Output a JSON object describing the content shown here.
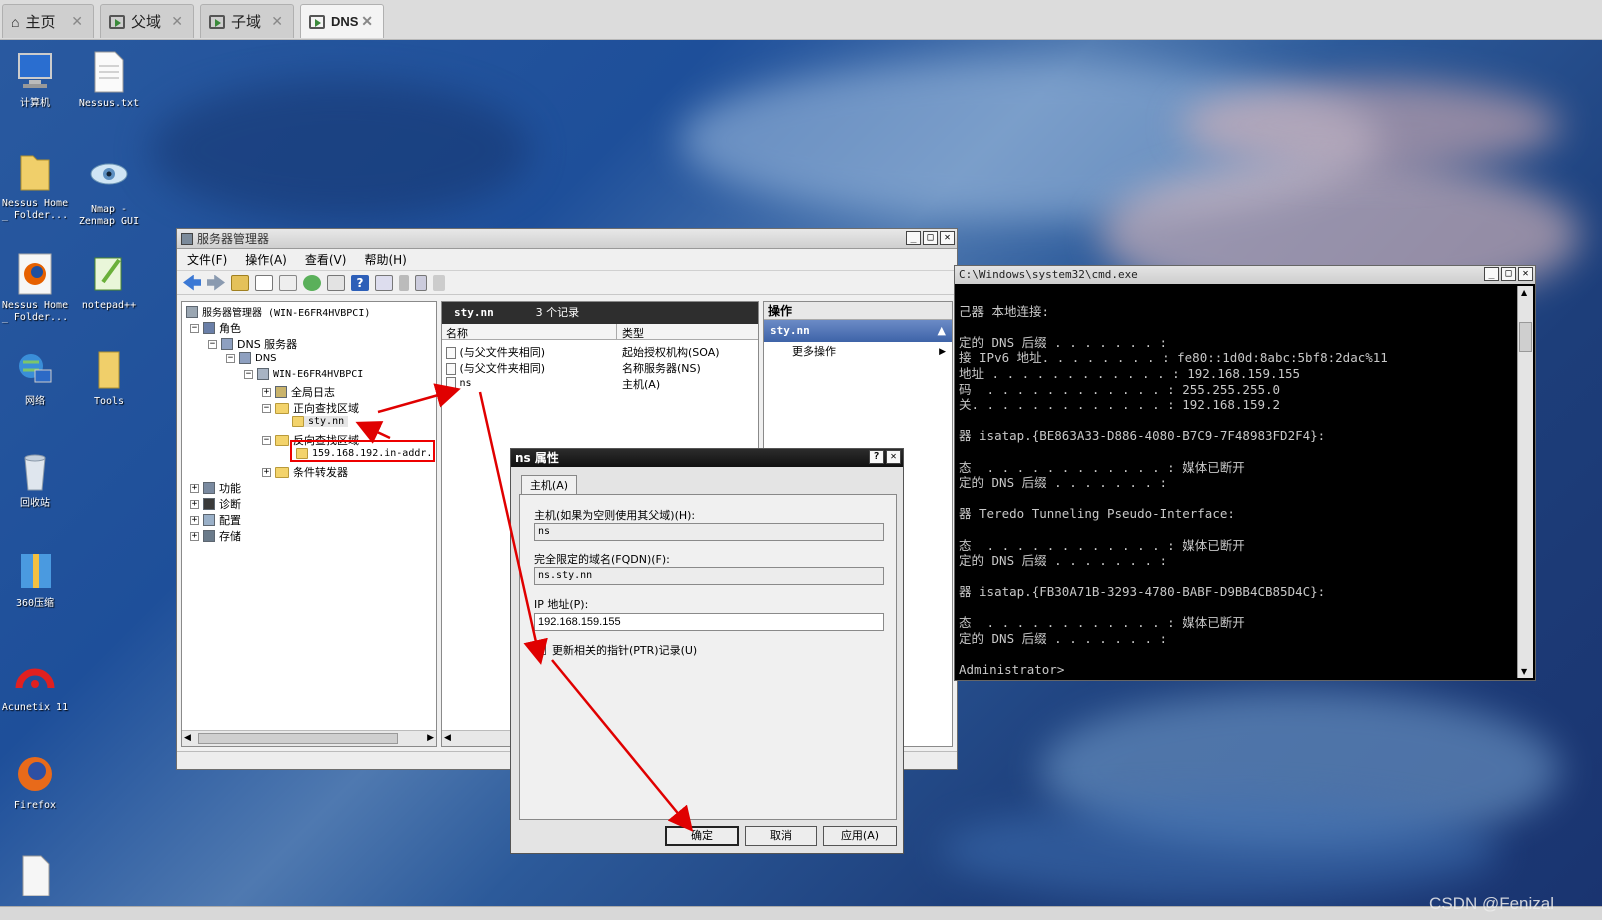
{
  "tabs": [
    {
      "label": "主页",
      "active": false
    },
    {
      "label": "父域",
      "active": false
    },
    {
      "label": "子域",
      "active": false
    },
    {
      "label": "DNS",
      "active": true
    }
  ],
  "desktop_icons": [
    {
      "label": "计算机",
      "icon": "computer-icon"
    },
    {
      "label": "Nessus.txt",
      "icon": "text-file-icon"
    },
    {
      "label": "Nessus Home _ Folder...",
      "icon": "folder-icon"
    },
    {
      "label": "Nmap - Zenmap GUI",
      "icon": "nmap-icon"
    },
    {
      "label": "Nessus Home _ Folder...",
      "icon": "firefox-icon"
    },
    {
      "label": "notepad++",
      "icon": "notepad-icon"
    },
    {
      "label": "网络",
      "icon": "network-icon"
    },
    {
      "label": "Tools",
      "icon": "folder-icon"
    },
    {
      "label": "回收站",
      "icon": "recycle-bin-icon"
    },
    {
      "label": "360压缩",
      "icon": "archive-icon"
    },
    {
      "label": "Acunetix 11",
      "icon": "acunetix-icon"
    },
    {
      "label": "Firefox",
      "icon": "firefox-icon"
    }
  ],
  "server_manager": {
    "title": "服务器管理器",
    "menu": [
      "文件(F)",
      "操作(A)",
      "查看(V)",
      "帮助(H)"
    ],
    "tree": {
      "root": "服务器管理器 (WIN-E6FR4HVBPCI)",
      "roles": "角色",
      "dns_service": "DNS 服务器",
      "dns": "DNS",
      "host": "WIN-E6FR4HVBPCI",
      "global_log": "全局日志",
      "forward_zones": "正向查找区域",
      "zone": "sty.nn",
      "reverse_zones": "反向查找区域",
      "reverse_zone": "159.168.192.in-addr.",
      "forwarders": "条件转发器",
      "features": "功能",
      "diagnostics": "诊断",
      "config": "配置",
      "storage": "存储"
    },
    "list": {
      "header_zone": "sty.nn",
      "header_count": "3 个记录",
      "col_name": "名称",
      "col_type": "类型",
      "rows": [
        {
          "name": "(与父文件夹相同)",
          "type": "起始授权机构(SOA)"
        },
        {
          "name": "(与父文件夹相同)",
          "type": "名称服务器(NS)"
        },
        {
          "name": "ns",
          "type": "主机(A)"
        }
      ]
    },
    "actions": {
      "header": "操作",
      "zone": "sty.nn",
      "more": "更多操作"
    }
  },
  "dialog": {
    "title": "ns 属性",
    "tab": "主机(A)",
    "host_label": "主机(如果为空则使用其父域)(H):",
    "host_value": "ns",
    "fqdn_label": "完全限定的域名(FQDN)(F):",
    "fqdn_value": "ns.sty.nn",
    "ip_label": "IP 地址(P):",
    "ip_value": "192.168.159.155",
    "ptr_label": "更新相关的指针(PTR)记录(U)",
    "ptr_checked": true,
    "ok": "确定",
    "cancel": "取消",
    "apply": "应用(A)"
  },
  "cmd": {
    "title": "C:\\Windows\\system32\\cmd.exe",
    "lines": [
      "",
      "己器 本地连接:",
      "",
      "定的 DNS 后缀 . . . . . . . :",
      "接 IPv6 地址. . . . . . . . : fe80::1d0d:8abc:5bf8:2dac%11",
      "地址 . . . . . . . . . . . . : 192.168.159.155",
      "码  . . . . . . . . . . . . : 255.255.255.0",
      "关. . . . . . . . . . . . . : 192.168.159.2",
      "",
      "器 isatap.{BE863A33-D886-4080-B7C9-7F48983FD2F4}:",
      "",
      "态  . . . . . . . . . . . . : 媒体已断开",
      "定的 DNS 后缀 . . . . . . . :",
      "",
      "器 Teredo Tunneling Pseudo-Interface:",
      "",
      "态  . . . . . . . . . . . . : 媒体已断开",
      "定的 DNS 后缀 . . . . . . . :",
      "",
      "器 isatap.{FB30A71B-3293-4780-BABF-D9BB4CB85D4C}:",
      "",
      "态  . . . . . . . . . . . . : 媒体已断开",
      "定的 DNS 后缀 . . . . . . . :",
      "",
      "Administrator>"
    ]
  },
  "watermark": "CSDN @Fenizal",
  "colors": {
    "annotation_red": "#e00000",
    "cmd_bg": "#000000",
    "dark_header": "#2e2e2e"
  }
}
